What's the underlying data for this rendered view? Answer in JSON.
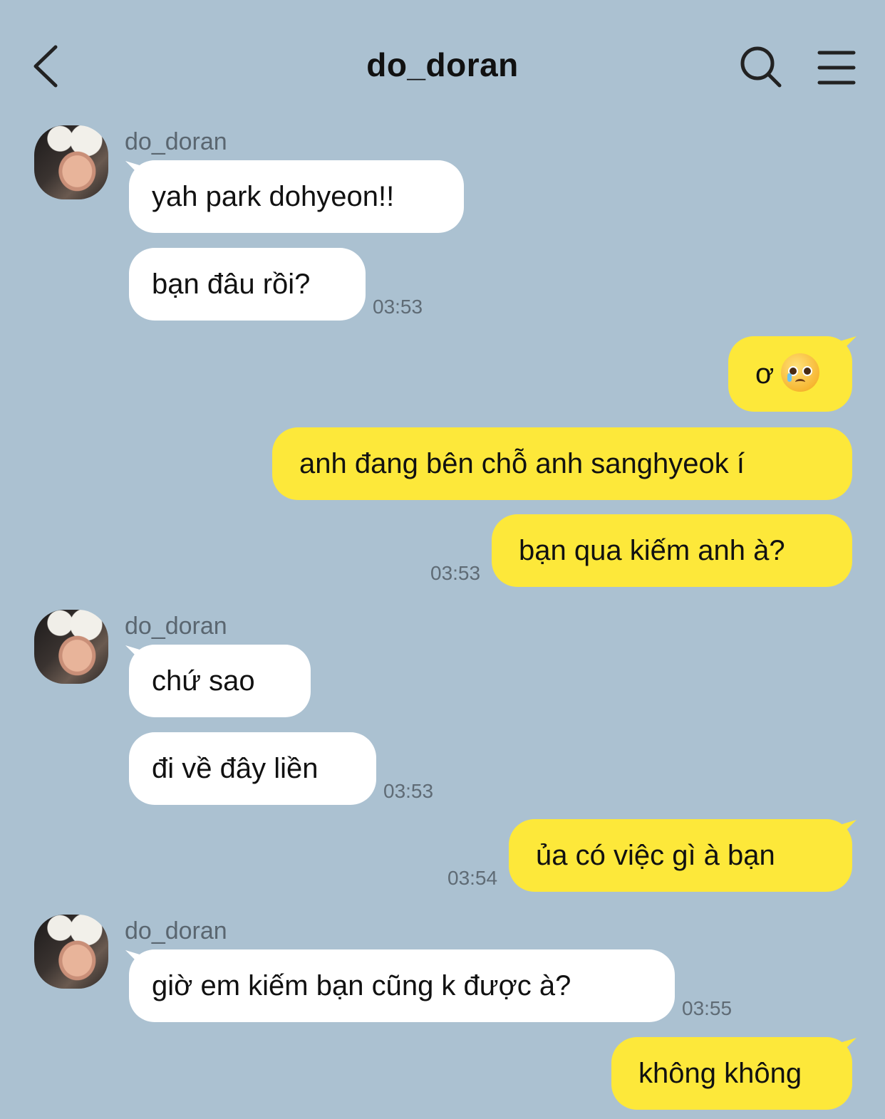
{
  "header": {
    "title": "do_doran",
    "back_icon": "chevron-left-icon",
    "search_icon": "search-icon",
    "menu_icon": "hamburger-menu-icon"
  },
  "colors": {
    "background": "#abc1d1",
    "incoming_bubble": "#ffffff",
    "outgoing_bubble": "#fde83a"
  },
  "messages": {
    "g1": {
      "sender": "do_doran",
      "m1": "yah park dohyeon!!",
      "m2": "bạn đâu rồi?",
      "time": "03:53"
    },
    "o1": {
      "m1": "ơ",
      "m1_emoji": "pleading-face-emoji",
      "m2": "anh đang bên chỗ anh sanghyeok í",
      "m3": "bạn qua kiếm anh à?",
      "time": "03:53"
    },
    "g2": {
      "sender": "do_doran",
      "m1": "chứ sao",
      "m2": "đi về đây liền",
      "time": "03:53"
    },
    "o2": {
      "m1": "ủa có việc gì à bạn",
      "time": "03:54"
    },
    "g3": {
      "sender": "do_doran",
      "m1": "giờ em kiếm bạn cũng k được à?",
      "time": "03:55"
    },
    "o3": {
      "m1": "không không"
    }
  }
}
